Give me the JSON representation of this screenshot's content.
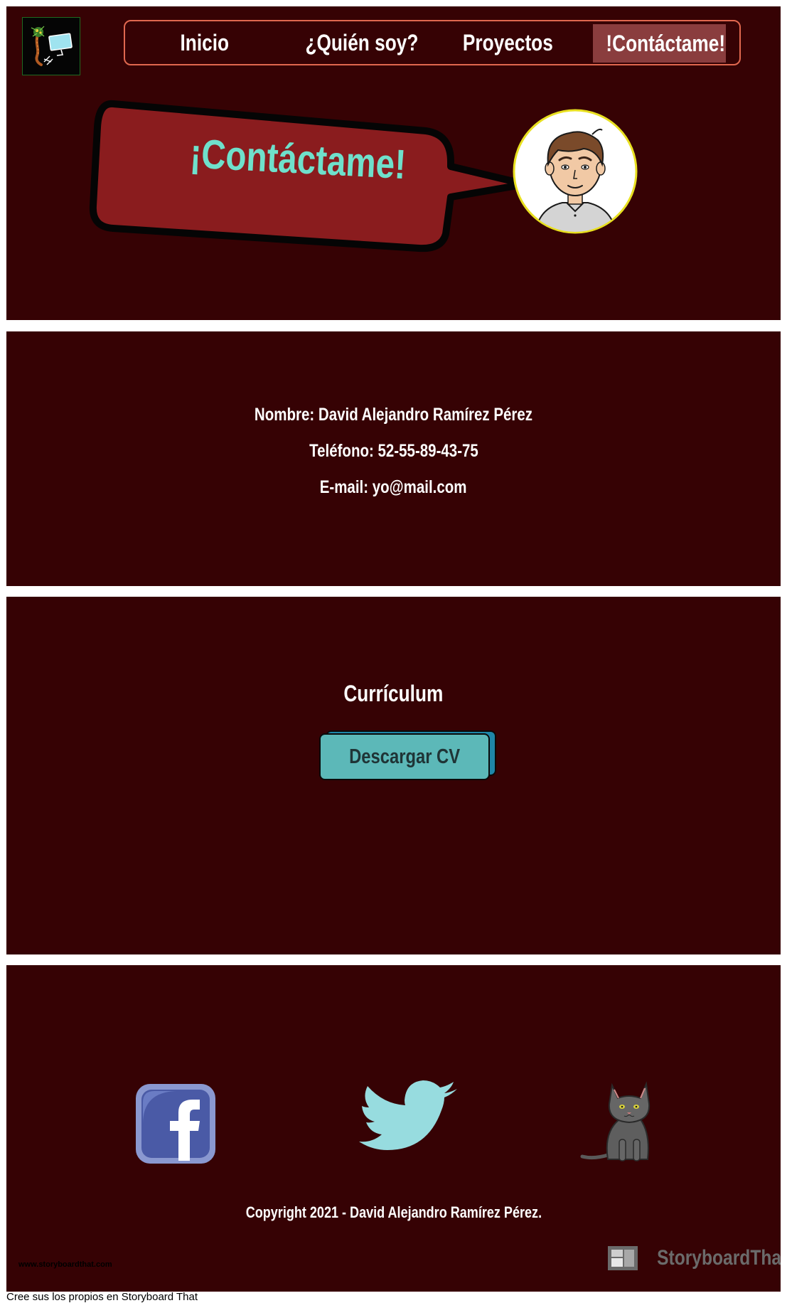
{
  "nav": {
    "items": [
      {
        "label": "Inicio"
      },
      {
        "label": "¿Quién soy?"
      },
      {
        "label": "Proyectos"
      },
      {
        "label": "!Contáctame!"
      }
    ],
    "active_index": 3
  },
  "hero": {
    "speech_bubble_text": "¡Contáctame!"
  },
  "contact": {
    "name_line": "Nombre: David Alejandro Ramírez Pérez",
    "phone_line": "Teléfono: 52-55-89-43-75",
    "email_line": "E-mail: yo@mail.com"
  },
  "cv": {
    "title": "Currículum",
    "button_label": "Descargar CV"
  },
  "social": {
    "icons": [
      "facebook-icon",
      "twitter-icon",
      "cat-icon"
    ]
  },
  "footer": {
    "copyright": "Copyright 2021 - David Alejandro Ramírez Pérez.",
    "watermark_url": "www.storyboardthat.com",
    "watermark_brand": "StoryboardThat",
    "note": "Cree sus los propios en Storyboard That"
  },
  "colors": {
    "panel_background": "#360204",
    "nav_border": "#e0684f",
    "nav_active": "#8a3d3e",
    "bubble_fill": "#8a1c1e",
    "bubble_text": "#6fe0cb",
    "button_fill": "#5cb8b8",
    "button_shadow": "#1f86a8",
    "avatar_ring": "#e8e020"
  }
}
